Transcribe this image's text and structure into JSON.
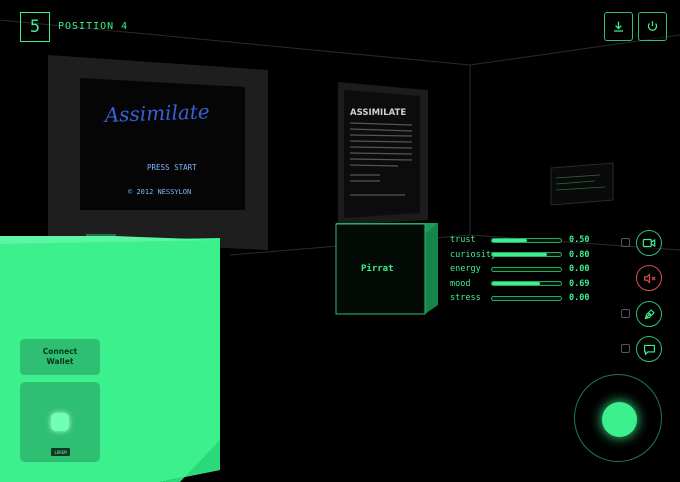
{
  "hud": {
    "slot_number": "5",
    "position_label": "POSITION 4"
  },
  "toolbar": {
    "download_icon": "download-icon",
    "power_icon": "power-icon"
  },
  "scene": {
    "game_screen": {
      "logo": "Assimilate",
      "press_start": "PRESS START",
      "copyright": "© 2012 NESSYLON"
    },
    "poster": {
      "title": "ASSIMILATE"
    },
    "cube_label": "Pirrat"
  },
  "stats": [
    {
      "label": "trust",
      "value": "0.50",
      "level": 0.5
    },
    {
      "label": "curiosity",
      "value": "0.80",
      "level": 0.8
    },
    {
      "label": "energy",
      "value": "0.00",
      "level": 0.0
    },
    {
      "label": "mood",
      "value": "0.69",
      "level": 0.69
    },
    {
      "label": "stress",
      "value": "0.00",
      "level": 0.0
    }
  ],
  "actions": {
    "camera_icon": "video-camera-icon",
    "mute_icon": "speaker-muted-icon",
    "pen_icon": "pen-tool-icon",
    "chat_icon": "chat-bubble-icon"
  },
  "controls": {
    "connect_wallet": "Connect Wallet",
    "pad_tag": "LOREM"
  },
  "colors": {
    "accent": "#3cf08e",
    "mute_red": "#d9504a"
  }
}
